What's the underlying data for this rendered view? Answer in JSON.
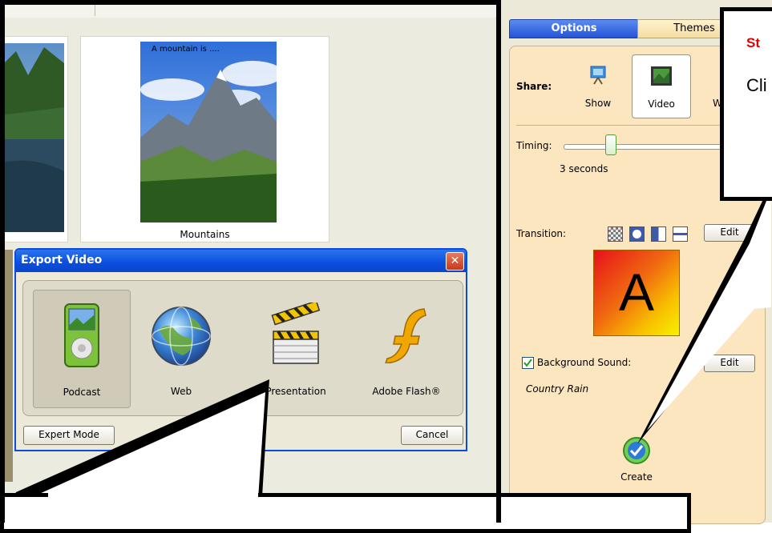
{
  "browser": {
    "photos": [
      {
        "caption": ""
      },
      {
        "caption": "Mountains",
        "overlay_text": "A mountain is ...."
      }
    ]
  },
  "side_panel": {
    "tabs": [
      {
        "label": "Options",
        "active": true
      },
      {
        "label": "Themes",
        "active": false
      }
    ],
    "share_label": "Share:",
    "share_options": [
      {
        "label": "Show"
      },
      {
        "label": "Video",
        "selected": true
      },
      {
        "label": "W"
      }
    ],
    "timing_label": "Timing:",
    "timing_value": "3 seconds",
    "timing_fraction": 0.3,
    "transition_label": "Transition:",
    "transition_edit": "Edit",
    "transition_preview_letter": "A",
    "bg_sound_label": "Background Sound:",
    "bg_sound_checked": true,
    "bg_sound_edit": "Edit",
    "bg_sound_track": "Country Rain",
    "create_label": "Create"
  },
  "export_dialog": {
    "title": "Export Video",
    "options": [
      {
        "label": "Podcast",
        "icon": "ipod-icon"
      },
      {
        "label": "Web",
        "icon": "globe-icon"
      },
      {
        "label": "Presentation",
        "icon": "clapperboard-icon"
      },
      {
        "label": "Adobe Flash®",
        "icon": "flash-icon"
      }
    ],
    "expert_mode": "Expert Mode",
    "cancel": "Cancel"
  },
  "callouts": {
    "top_right": {
      "heading": "St",
      "body": "Cli"
    }
  },
  "colors": {
    "accent": "#0a4be0",
    "panel": "#fbe6bf",
    "callout_heading": "#e00000"
  }
}
